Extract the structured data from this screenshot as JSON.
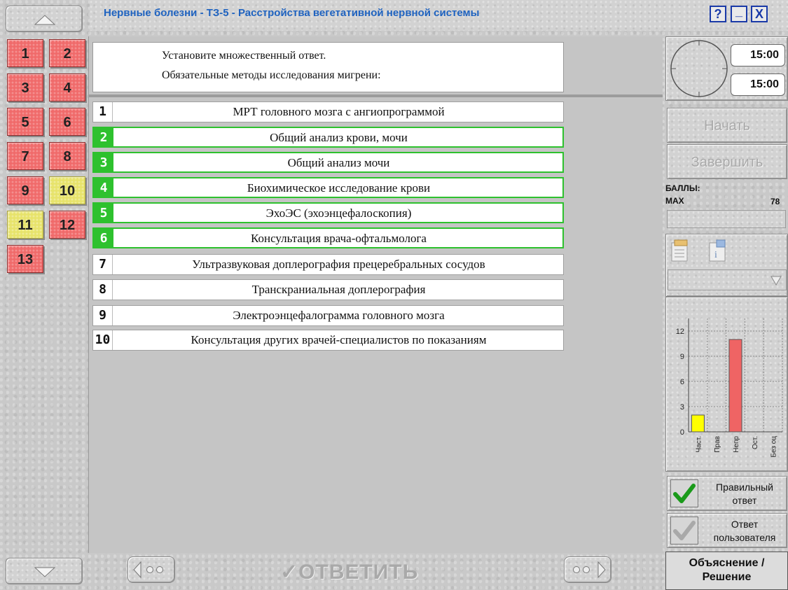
{
  "window": {
    "title": "Нервные болезни - ТЗ-5 - Расстройства вегетативной нервной системы",
    "help_label": "?",
    "minimize_label": "_",
    "close_label": "X"
  },
  "questions_nav": [
    {
      "label": "1",
      "status": "red"
    },
    {
      "label": "2",
      "status": "red"
    },
    {
      "label": "3",
      "status": "red"
    },
    {
      "label": "4",
      "status": "red"
    },
    {
      "label": "5",
      "status": "red"
    },
    {
      "label": "6",
      "status": "red"
    },
    {
      "label": "7",
      "status": "red"
    },
    {
      "label": "8",
      "status": "red"
    },
    {
      "label": "9",
      "status": "red"
    },
    {
      "label": "10",
      "status": "yellow"
    },
    {
      "label": "11",
      "status": "yellow"
    },
    {
      "label": "12",
      "status": "red"
    },
    {
      "label": "13",
      "status": "red"
    }
  ],
  "question": {
    "instruction": "Установите множественный ответ.",
    "text": "Обязательные методы исследования мигрени:"
  },
  "options": [
    {
      "num": "1",
      "text": "МРТ головного мозга с ангиопрограммой",
      "selected": false
    },
    {
      "num": "2",
      "text": "Общий анализ крови, мочи",
      "selected": true
    },
    {
      "num": "3",
      "text": "Общий анализ мочи",
      "selected": true
    },
    {
      "num": "4",
      "text": "Биохимическое исследование крови",
      "selected": true
    },
    {
      "num": "5",
      "text": "ЭхоЭС (эхоэнцефалоскопия)",
      "selected": true
    },
    {
      "num": "6",
      "text": "Консультация врача-офтальмолога",
      "selected": true
    },
    {
      "num": "7",
      "text": "Ультразвуковая доплерография прецеребральных сосудов",
      "selected": false
    },
    {
      "num": "8",
      "text": "Транскраниальная доплерография",
      "selected": false
    },
    {
      "num": "9",
      "text": "Электроэнцефалограмма головного мозга",
      "selected": false
    },
    {
      "num": "10",
      "text": "Консультация других врачей-специалистов по показаниям",
      "selected": false
    }
  ],
  "bottom": {
    "answer_label": "ОТВЕТИТЬ",
    "explain_label_1": "Объяснение /",
    "explain_label_2": "Решение"
  },
  "timer": {
    "time_total": "15:00",
    "time_left": "15:00"
  },
  "controls": {
    "start_label": "Начать",
    "finish_label": "Завершить"
  },
  "score": {
    "label": "БАЛЛЫ:",
    "max_label": "MAX",
    "max_value": "78"
  },
  "legend": {
    "correct_label_1": "Правильный",
    "correct_label_2": "ответ",
    "user_label_1": "Ответ",
    "user_label_2": "пользователя"
  },
  "colors": {
    "partial": "#ffff00",
    "wrong": "#ef6464",
    "selected": "#2ec12e",
    "title": "#1f63c0"
  },
  "chart_data": {
    "type": "bar",
    "categories": [
      "Част.",
      "Прав",
      "Непр",
      "Ост.",
      "Без оц"
    ],
    "values": [
      2,
      0,
      11,
      0,
      0
    ],
    "colors": [
      "#ffff00",
      "#ef6464",
      "#ef6464",
      "#ef6464",
      "#ef6464"
    ],
    "yticks": [
      0,
      3,
      6,
      9,
      12
    ],
    "ylim": [
      0,
      13
    ],
    "grid": true
  }
}
